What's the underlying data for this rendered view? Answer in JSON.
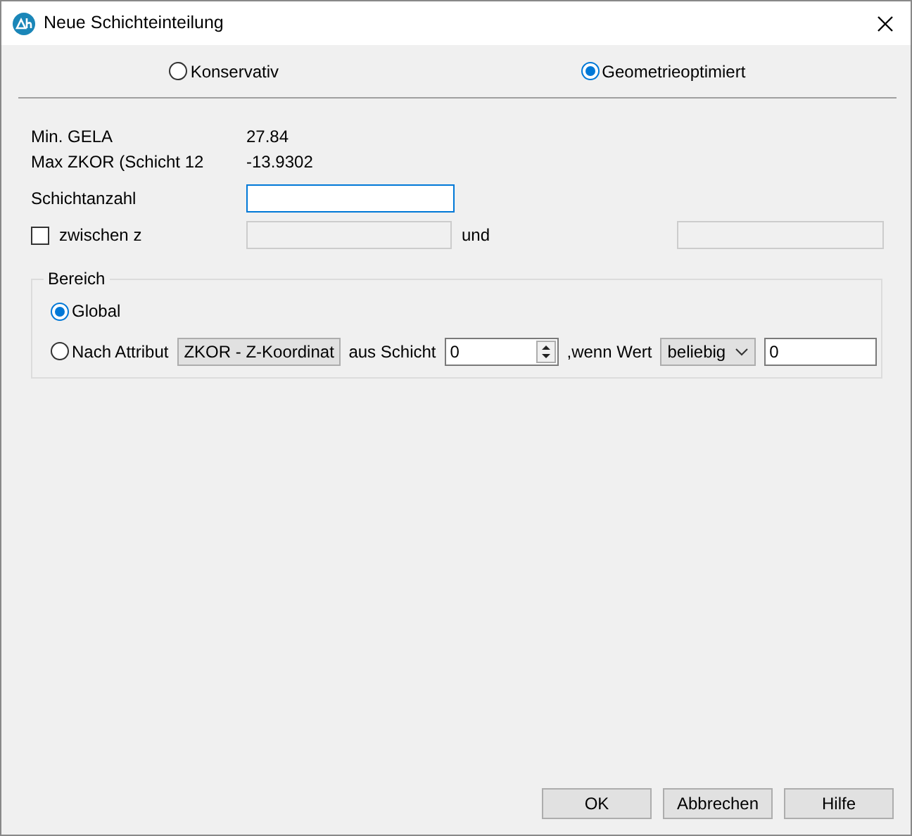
{
  "window": {
    "title": "Neue Schichteinteilung"
  },
  "modes": [
    {
      "label": "Konservativ",
      "selected": false
    },
    {
      "label": "Geometrieoptimiert",
      "selected": true
    }
  ],
  "info": [
    {
      "label": "Min. GELA",
      "value": "27.84"
    },
    {
      "label": "Max ZKOR (Schicht 12",
      "value": "-13.9302"
    }
  ],
  "layer_count": {
    "label": "Schichtanzahl",
    "focused": true
  },
  "between": {
    "label": "zwischen z",
    "checked": false,
    "and_label": "und",
    "fields_disabled": true
  },
  "range": {
    "title": "Bereich",
    "options": [
      {
        "label": "Global",
        "selected": true
      },
      {
        "label": "Nach Attribut",
        "selected": false
      }
    ],
    "attribute": "ZKOR - Z-Koordinat",
    "layer_label": "aus Schicht",
    "layer": "0",
    "condition_label": ",wenn Wert",
    "condition": "beliebig",
    "value": "0"
  },
  "buttons": [
    "OK",
    "Abbrechen",
    "Hilfe"
  ]
}
